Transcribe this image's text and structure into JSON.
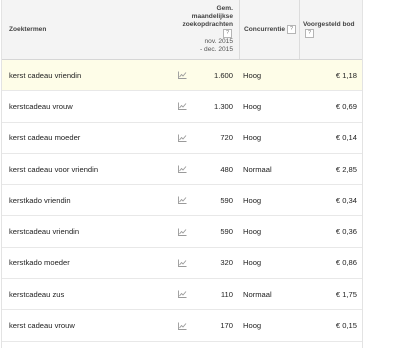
{
  "table": {
    "columns": {
      "keyword": "Zoektermen",
      "volume_line1": "Gem.",
      "volume_line2": "maandelijkse",
      "volume_line3": "zoekopdrachten",
      "volume_range_line1": "nov. 2015",
      "volume_range_line2": "- dec. 2015",
      "competition": "Concurrentie",
      "bid": "Voorgesteld bod"
    },
    "help_label": "?",
    "rows": [
      {
        "keyword": "kerst cadeau vriendin",
        "volume": "1.600",
        "competition": "Hoog",
        "bid": "€ 1,18"
      },
      {
        "keyword": "kerstcadeau vrouw",
        "volume": "1.300",
        "competition": "Hoog",
        "bid": "€ 0,69"
      },
      {
        "keyword": "kerst cadeau moeder",
        "volume": "720",
        "competition": "Hoog",
        "bid": "€ 0,14"
      },
      {
        "keyword": "kerst cadeau voor vriendin",
        "volume": "480",
        "competition": "Normaal",
        "bid": "€ 2,85"
      },
      {
        "keyword": "kerstkado vriendin",
        "volume": "590",
        "competition": "Hoog",
        "bid": "€ 0,34"
      },
      {
        "keyword": "kerstcadeau vriendin",
        "volume": "590",
        "competition": "Hoog",
        "bid": "€ 0,36"
      },
      {
        "keyword": "kerstkado moeder",
        "volume": "320",
        "competition": "Hoog",
        "bid": "€ 0,86"
      },
      {
        "keyword": "kerstcadeau zus",
        "volume": "110",
        "competition": "Normaal",
        "bid": "€ 1,75"
      },
      {
        "keyword": "kerst cadeau vrouw",
        "volume": "170",
        "competition": "Hoog",
        "bid": "€ 0,15"
      }
    ]
  },
  "icons": {
    "trend": "trend-chart-icon",
    "help": "help-icon"
  },
  "colors": {
    "highlight_row": "#fefde8",
    "header_bg": "#f4f4f4"
  }
}
